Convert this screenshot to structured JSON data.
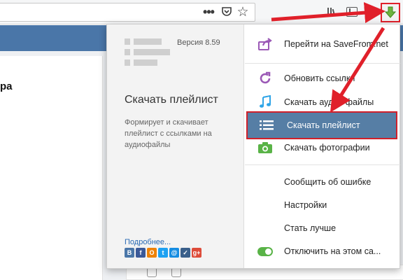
{
  "toolbar": {
    "menu_dots": "•••",
    "star": "☆"
  },
  "page": {
    "fragment_text": "ра"
  },
  "popup": {
    "version": "Версия 8.59",
    "title": "Скачать плейлист",
    "description": "Формирует и скачивает плейлист с ссылками на аудиофайлы",
    "more_link": "Подробнее...",
    "socials": [
      {
        "label": "B",
        "color": "#4a76a8"
      },
      {
        "label": "f",
        "color": "#3b5998"
      },
      {
        "label": "О",
        "color": "#ee8208"
      },
      {
        "label": "t",
        "color": "#1da1f2"
      },
      {
        "label": "@",
        "color": "#168de2"
      },
      {
        "label": "✓",
        "color": "#3a5f8a"
      },
      {
        "label": "g+",
        "color": "#dd4b39"
      }
    ],
    "menu": {
      "goto": "Перейти на SaveFrom.net",
      "refresh": "Обновить ссылки",
      "audio": "Скачать аудио файлы",
      "playlist": "Скачать плейлист",
      "photos": "Скачать фотографии",
      "report": "Сообщить об ошибке",
      "settings": "Настройки",
      "improve": "Стать лучше",
      "disable": "Отключить на этом са..."
    }
  },
  "colors": {
    "accent_red": "#e0202a",
    "menu_active": "#567ea5",
    "icon_purple": "#9b59b6",
    "icon_green": "#59b347"
  }
}
